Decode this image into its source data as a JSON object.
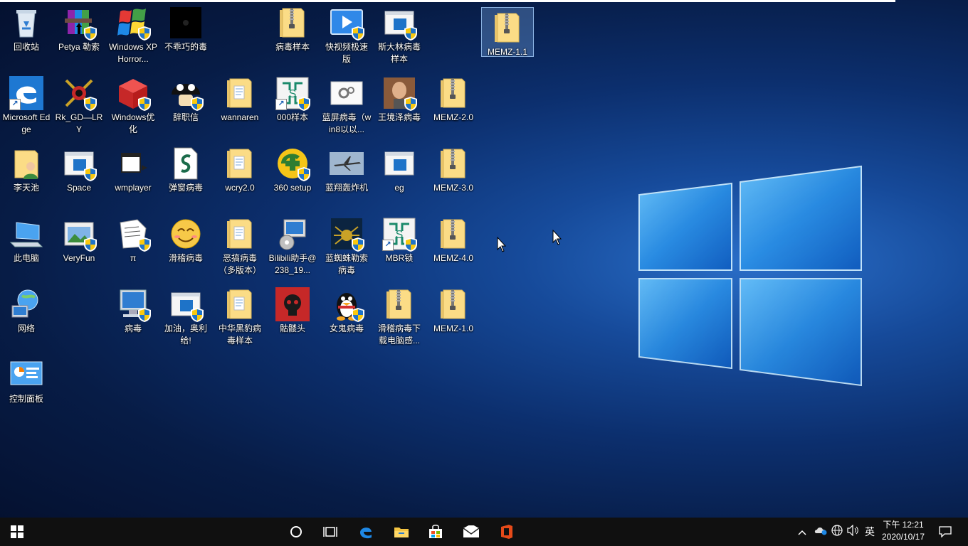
{
  "desktop_icons": [
    {
      "label": "回收站",
      "icon": "recycle-bin-icon"
    },
    {
      "label": "Petya 勒索",
      "icon": "winrar-archive-icon"
    },
    {
      "label": "Windows XP Horror...",
      "icon": "windows-xp-logo-icon"
    },
    {
      "label": "不乖巧的毒",
      "icon": "black-file-icon"
    },
    {
      "label": "病毒样本",
      "icon": "zip-folder-icon"
    },
    {
      "label": "快视频极速版",
      "icon": "video-app-icon"
    },
    {
      "label": "斯大林病毒样本",
      "icon": "window-app-icon"
    },
    {
      "label": "MEMZ-1.1",
      "icon": "zip-folder-icon"
    },
    {
      "label": "Microsoft Edge",
      "icon": "edge-icon"
    },
    {
      "label": "Rk_GD—LRY",
      "icon": "crossed-swords-icon"
    },
    {
      "label": "Windows优化",
      "icon": "red-cube-icon"
    },
    {
      "label": "辞职信",
      "icon": "mushroom-icon"
    },
    {
      "label": "wannaren",
      "icon": "folder-icon"
    },
    {
      "label": "000样本",
      "icon": "circuit-icon"
    },
    {
      "label": "蓝屏病毒（win8以以...",
      "icon": "gear-icon"
    },
    {
      "label": "王境泽病毒",
      "icon": "photo-icon"
    },
    {
      "label": "MEMZ-2.0",
      "icon": "zip-folder-icon"
    },
    {
      "label": "李天池",
      "icon": "user-folder-icon"
    },
    {
      "label": "Space",
      "icon": "window-app-icon"
    },
    {
      "label": "wmplayer",
      "icon": "window-arrow-icon"
    },
    {
      "label": "弹窗病毒",
      "icon": "script-file-icon"
    },
    {
      "label": "wcry2.0",
      "icon": "folder-icon"
    },
    {
      "label": "360 setup",
      "icon": "360-installer-icon"
    },
    {
      "label": "蓝翔轰炸机",
      "icon": "bomber-plane-icon"
    },
    {
      "label": "eg",
      "icon": "window-app-icon"
    },
    {
      "label": "MEMZ-3.0",
      "icon": "zip-folder-icon"
    },
    {
      "label": "此电脑",
      "icon": "computer-icon"
    },
    {
      "label": "VeryFun",
      "icon": "picture-window-icon"
    },
    {
      "label": "π",
      "icon": "document-icon"
    },
    {
      "label": "滑稽病毒",
      "icon": "smiley-face-icon"
    },
    {
      "label": "恶搞病毒（多版本）",
      "icon": "folder-icon"
    },
    {
      "label": "Bilibili助手@238_19...",
      "icon": "installer-disc-icon"
    },
    {
      "label": "蓝蜘蛛勒索病毒",
      "icon": "blue-spider-icon"
    },
    {
      "label": "MBR锁",
      "icon": "circuit-icon"
    },
    {
      "label": "MEMZ-4.0",
      "icon": "zip-folder-icon"
    },
    {
      "label": "网络",
      "icon": "network-globe-icon"
    },
    {
      "label": "病毒",
      "icon": "computer-monitor-icon"
    },
    {
      "label": "加油，奥利给!",
      "icon": "window-app-icon"
    },
    {
      "label": "中华黑豹病毒样本",
      "icon": "folder-icon"
    },
    {
      "label": "骷髅头",
      "icon": "skull-icon"
    },
    {
      "label": "女鬼病毒",
      "icon": "qq-penguin-icon"
    },
    {
      "label": "滑稽病毒下载电脑感...",
      "icon": "zip-folder-icon"
    },
    {
      "label": "MEMZ-1.0",
      "icon": "zip-folder-icon"
    },
    {
      "label": "控制面板",
      "icon": "control-panel-icon"
    }
  ],
  "taskbar": {
    "start": "windows-start-icon",
    "pinned": [
      "cortana-circle-icon",
      "task-view-icon",
      "edge-icon",
      "file-explorer-icon",
      "store-icon",
      "mail-icon",
      "office-icon"
    ],
    "tray": [
      "chevron-up-icon",
      "onedrive-icon",
      "globe-icon",
      "volume-icon"
    ],
    "ime": "英",
    "time": "下午 12:21",
    "date": "2020/10/17",
    "notifications": "notification-icon"
  }
}
